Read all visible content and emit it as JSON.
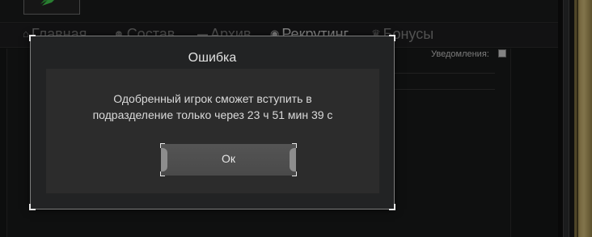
{
  "nav": {
    "items": [
      {
        "label": "Главная",
        "icon": "home-icon",
        "active": false
      },
      {
        "label": "Состав",
        "icon": "users-icon",
        "active": false
      },
      {
        "label": "Архив",
        "icon": "folder-icon",
        "active": false
      },
      {
        "label": "Рекрутинг",
        "icon": "recruit-icon",
        "active": true
      },
      {
        "label": "Бонусы",
        "icon": "bonus-icon",
        "active": false
      }
    ]
  },
  "notifications": {
    "label": "Уведомления:",
    "checked": true
  },
  "dialog": {
    "title": "Ошибка",
    "message_line1": "Одобренный игрок сможет вступить в",
    "message_line2": "подразделение только через 23 ч 51 мин 39 с",
    "ok_label": "Ок"
  },
  "colors": {
    "frame_gold": "#b9a365",
    "background": "#151616"
  }
}
